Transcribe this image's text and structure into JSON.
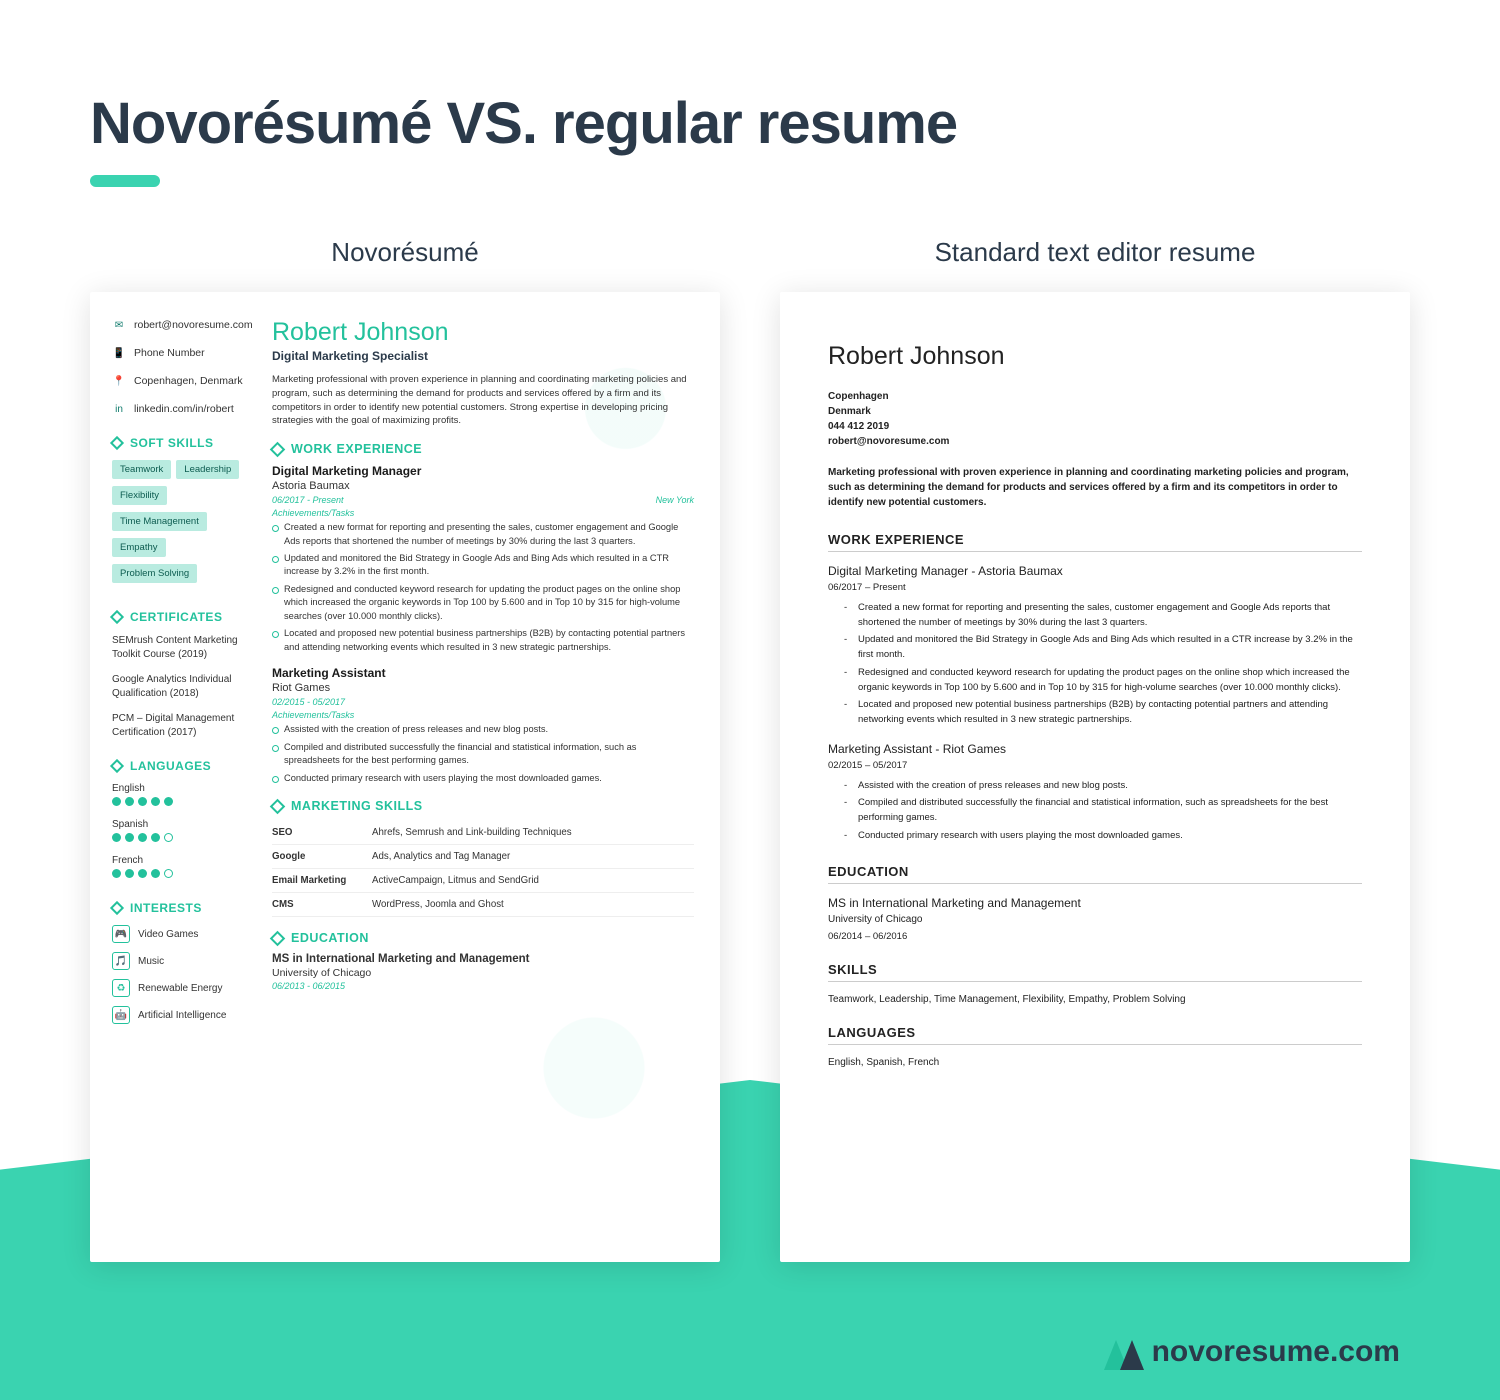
{
  "headline": "Novorésumé VS. regular resume",
  "left_title": "Novorésumé",
  "right_title": "Standard text editor resume",
  "brand": "novoresume.com",
  "novo": {
    "contacts": {
      "email": "robert@novoresume.com",
      "phone": "Phone Number",
      "location": "Copenhagen, Denmark",
      "linkedin": "linkedin.com/in/robert"
    },
    "name": "Robert Johnson",
    "title": "Digital Marketing Specialist",
    "summary": "Marketing professional with proven experience in planning and coordinating marketing policies and program, such as determining the demand for products and services offered by a firm and its competitors in order to identify new potential customers. Strong expertise in developing pricing strategies with the goal of maximizing profits.",
    "sections": {
      "soft": "SOFT SKILLS",
      "cert": "CERTIFICATES",
      "lang": "LANGUAGES",
      "interests": "INTERESTS",
      "work": "WORK EXPERIENCE",
      "mskills": "MARKETING SKILLS",
      "edu": "EDUCATION"
    },
    "soft_skills": [
      "Teamwork",
      "Leadership",
      "Flexibility",
      "Time Management",
      "Empathy",
      "Problem Solving"
    ],
    "certificates": [
      "SEMrush Content Marketing Toolkit Course (2019)",
      "Google Analytics Individual Qualification (2018)",
      "PCM – Digital Management Certification (2017)"
    ],
    "languages": [
      {
        "name": "English",
        "level": 5
      },
      {
        "name": "Spanish",
        "level": 4
      },
      {
        "name": "French",
        "level": 4
      }
    ],
    "interests": [
      "Video Games",
      "Music",
      "Renewable Energy",
      "Artificial Intelligence"
    ],
    "jobs": [
      {
        "title": "Digital Marketing Manager",
        "company": "Astoria Baumax",
        "dates": "06/2017 - Present",
        "loc": "New York",
        "ach": "Achievements/Tasks",
        "bullets": [
          "Created a new format for reporting and presenting the sales, customer engagement and Google Ads reports that shortened the number of meetings by 30% during the last 3 quarters.",
          "Updated and monitored the Bid Strategy in Google Ads and Bing Ads which resulted in a CTR increase by 3.2% in the first month.",
          "Redesigned and conducted keyword research for updating the product pages on the online shop which increased the organic keywords in Top 100 by 5.600 and in Top 10 by 315 for high-volume searches (over 10.000 monthly clicks).",
          "Located and proposed new potential business partnerships (B2B) by contacting potential partners and attending networking events which resulted in 3 new strategic partnerships."
        ]
      },
      {
        "title": "Marketing Assistant",
        "company": "Riot Games",
        "dates": "02/2015 - 05/2017",
        "loc": "",
        "ach": "Achievements/Tasks",
        "bullets": [
          "Assisted with the creation of press releases and new blog posts.",
          "Compiled and distributed successfully the financial and statistical information, such as spreadsheets for the best performing games.",
          "Conducted primary research with users playing the most downloaded games."
        ]
      }
    ],
    "mskills": [
      {
        "k": "SEO",
        "v": "Ahrefs, Semrush and Link-building Techniques"
      },
      {
        "k": "Google",
        "v": "Ads, Analytics and Tag Manager"
      },
      {
        "k": "Email Marketing",
        "v": "ActiveCampaign, Litmus and SendGrid"
      },
      {
        "k": "CMS",
        "v": "WordPress, Joomla and Ghost"
      }
    ],
    "education": {
      "degree": "MS in International Marketing and Management",
      "school": "University of Chicago",
      "dates": "06/2013 - 06/2015"
    }
  },
  "std": {
    "name": "Robert Johnson",
    "info": [
      "Copenhagen",
      "Denmark",
      "044 412 2019",
      "robert@novoresume.com"
    ],
    "summary": "Marketing professional with proven experience in planning and coordinating marketing policies and program, such as determining the demand for products and services offered by a firm and its competitors in order to identify new potential customers.",
    "h_work": "WORK EXPERIENCE",
    "jobs": [
      {
        "role": "Digital Marketing Manager  - Astoria Baumax",
        "dates": "06/2017 – Present",
        "bullets": [
          "Created a new format for reporting and presenting the sales, customer engagement and Google Ads reports that shortened the number of meetings by 30% during the last 3 quarters.",
          "Updated and monitored the Bid Strategy in Google Ads and Bing Ads which resulted in a CTR increase by 3.2% in the first month.",
          "Redesigned and conducted keyword research for updating the product pages on the online shop which increased the organic keywords in Top 100 by 5.600 and in Top 10 by 315 for high-volume searches (over 10.000 monthly clicks).",
          "Located and proposed new potential business partnerships (B2B) by contacting potential partners and attending networking events which resulted in 3 new strategic partnerships."
        ]
      },
      {
        "role": "Marketing Assistant - Riot Games",
        "dates": "02/2015 – 05/2017",
        "bullets": [
          "Assisted with the creation of press releases and new blog posts.",
          "Compiled and distributed successfully the financial and statistical information, such as spreadsheets for the best performing games.",
          "Conducted primary research with users playing the most downloaded games."
        ]
      }
    ],
    "h_edu": "EDUCATION",
    "edu": {
      "degree": "MS in International Marketing and Management",
      "school": "University of Chicago",
      "dates": "06/2014 – 06/2016"
    },
    "h_skills": "SKILLS",
    "skills": "Teamwork, Leadership, Time Management, Flexibility, Empathy, Problem Solving",
    "h_lang": "LANGUAGES",
    "lang": "English, Spanish, French"
  }
}
